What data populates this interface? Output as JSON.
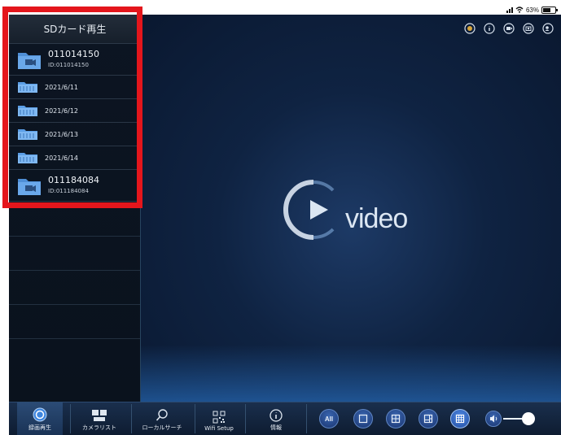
{
  "status": {
    "battery": "63%"
  },
  "sidebar": {
    "title": "SDカード再生",
    "devices": [
      {
        "name": "011014150",
        "id": "ID:011014150"
      },
      {
        "name": "011184084",
        "id": "ID:011184084"
      }
    ],
    "dates": [
      "2021/6/11",
      "2021/6/12",
      "2021/6/13",
      "2021/6/14"
    ]
  },
  "player": {
    "logo_text": "video",
    "battery_level": 0.63
  },
  "tabs": [
    {
      "label": "録画再生",
      "icon": "record-playback-icon",
      "active": true
    },
    {
      "label": "カメラリスト",
      "icon": "camera-list-icon",
      "active": false
    },
    {
      "label": "ローカルサーチ",
      "icon": "search-icon",
      "active": false
    },
    {
      "label": "Wifi Setup",
      "icon": "qr-code-icon",
      "active": false
    },
    {
      "label": "情報",
      "icon": "info-icon",
      "active": false
    }
  ],
  "views": [
    {
      "label": "All",
      "icon": "all-view-icon"
    },
    {
      "label": "",
      "icon": "single-view-icon"
    },
    {
      "label": "",
      "icon": "quad-view-icon"
    },
    {
      "label": "",
      "icon": "six-view-icon"
    },
    {
      "label": "",
      "icon": "nine-view-icon"
    }
  ],
  "colors": {
    "highlight": "#e4161c",
    "accent": "#2350a5",
    "background": "#0a1422"
  }
}
